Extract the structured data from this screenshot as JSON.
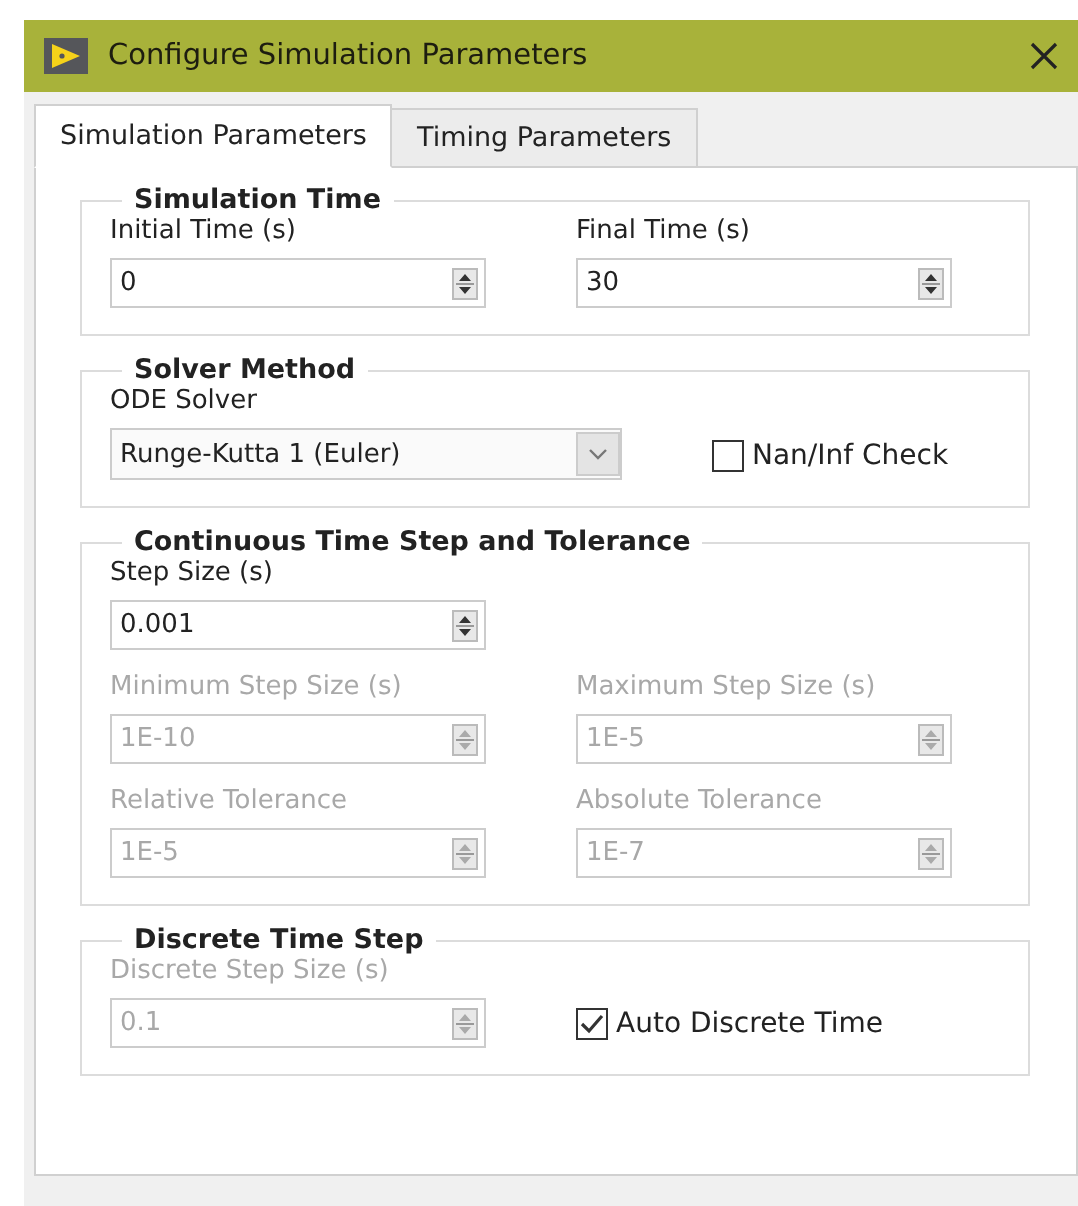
{
  "window": {
    "title": "Configure Simulation Parameters"
  },
  "tabs": [
    {
      "label": "Simulation Parameters",
      "selected": true
    },
    {
      "label": "Timing Parameters",
      "selected": false
    }
  ],
  "groups": [
    {
      "title": "Simulation Time",
      "rows": [
        [
          {
            "kind": "numeric",
            "label": "Initial Time (s)",
            "value": "0",
            "disabled": false
          },
          {
            "kind": "numeric",
            "label": "Final Time (s)",
            "value": "30",
            "disabled": false
          }
        ]
      ]
    },
    {
      "title": "Solver Method",
      "rows": [
        [
          {
            "kind": "dropdown",
            "label": "ODE Solver",
            "value": "Runge-Kutta 1 (Euler)",
            "disabled": false
          },
          {
            "kind": "checkbox",
            "label": "Nan/Inf Check",
            "checked": false,
            "disabled": false
          }
        ]
      ]
    },
    {
      "title": "Continuous Time Step and Tolerance",
      "rows": [
        [
          {
            "kind": "numeric",
            "label": "Step Size (s)",
            "value": "0.001",
            "disabled": false
          }
        ],
        [
          {
            "kind": "numeric",
            "label": "Minimum Step Size (s)",
            "value": "1E-10",
            "disabled": true
          },
          {
            "kind": "numeric",
            "label": "Maximum Step Size (s)",
            "value": "1E-5",
            "disabled": true
          }
        ],
        [
          {
            "kind": "numeric",
            "label": "Relative Tolerance",
            "value": "1E-5",
            "disabled": true
          },
          {
            "kind": "numeric",
            "label": "Absolute Tolerance",
            "value": "1E-7",
            "disabled": true
          }
        ]
      ]
    },
    {
      "title": "Discrete Time Step",
      "rows": [
        [
          {
            "kind": "numeric",
            "label": "Discrete Step Size (s)",
            "value": "0.1",
            "disabled": true
          },
          {
            "kind": "checkbox",
            "label": "Auto Discrete Time",
            "checked": true,
            "disabled": false
          }
        ]
      ]
    }
  ]
}
